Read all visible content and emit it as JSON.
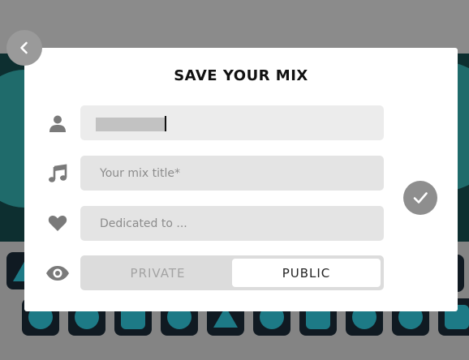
{
  "modal": {
    "title": "SAVE YOUR MIX",
    "name_field": {
      "value": ""
    },
    "title_field": {
      "placeholder": "Your mix title*"
    },
    "dedicated_field": {
      "placeholder": "Dedicated to ..."
    },
    "visibility": {
      "private_label": "PRIVATE",
      "public_label": "PUBLIC",
      "selected": "PUBLIC"
    }
  },
  "icons": {
    "back": "chevron-left-icon",
    "user": "user-icon",
    "music": "music-note-icon",
    "heart": "heart-icon",
    "eye": "eye-icon",
    "confirm": "checkmark-icon"
  },
  "colors": {
    "modal_background": "#ffffff",
    "field_background": "#e4e4e4",
    "icon_gray": "#7a7a7a",
    "confirm_button": "#8e8e8e",
    "background_teal": "#1f6b6b"
  }
}
